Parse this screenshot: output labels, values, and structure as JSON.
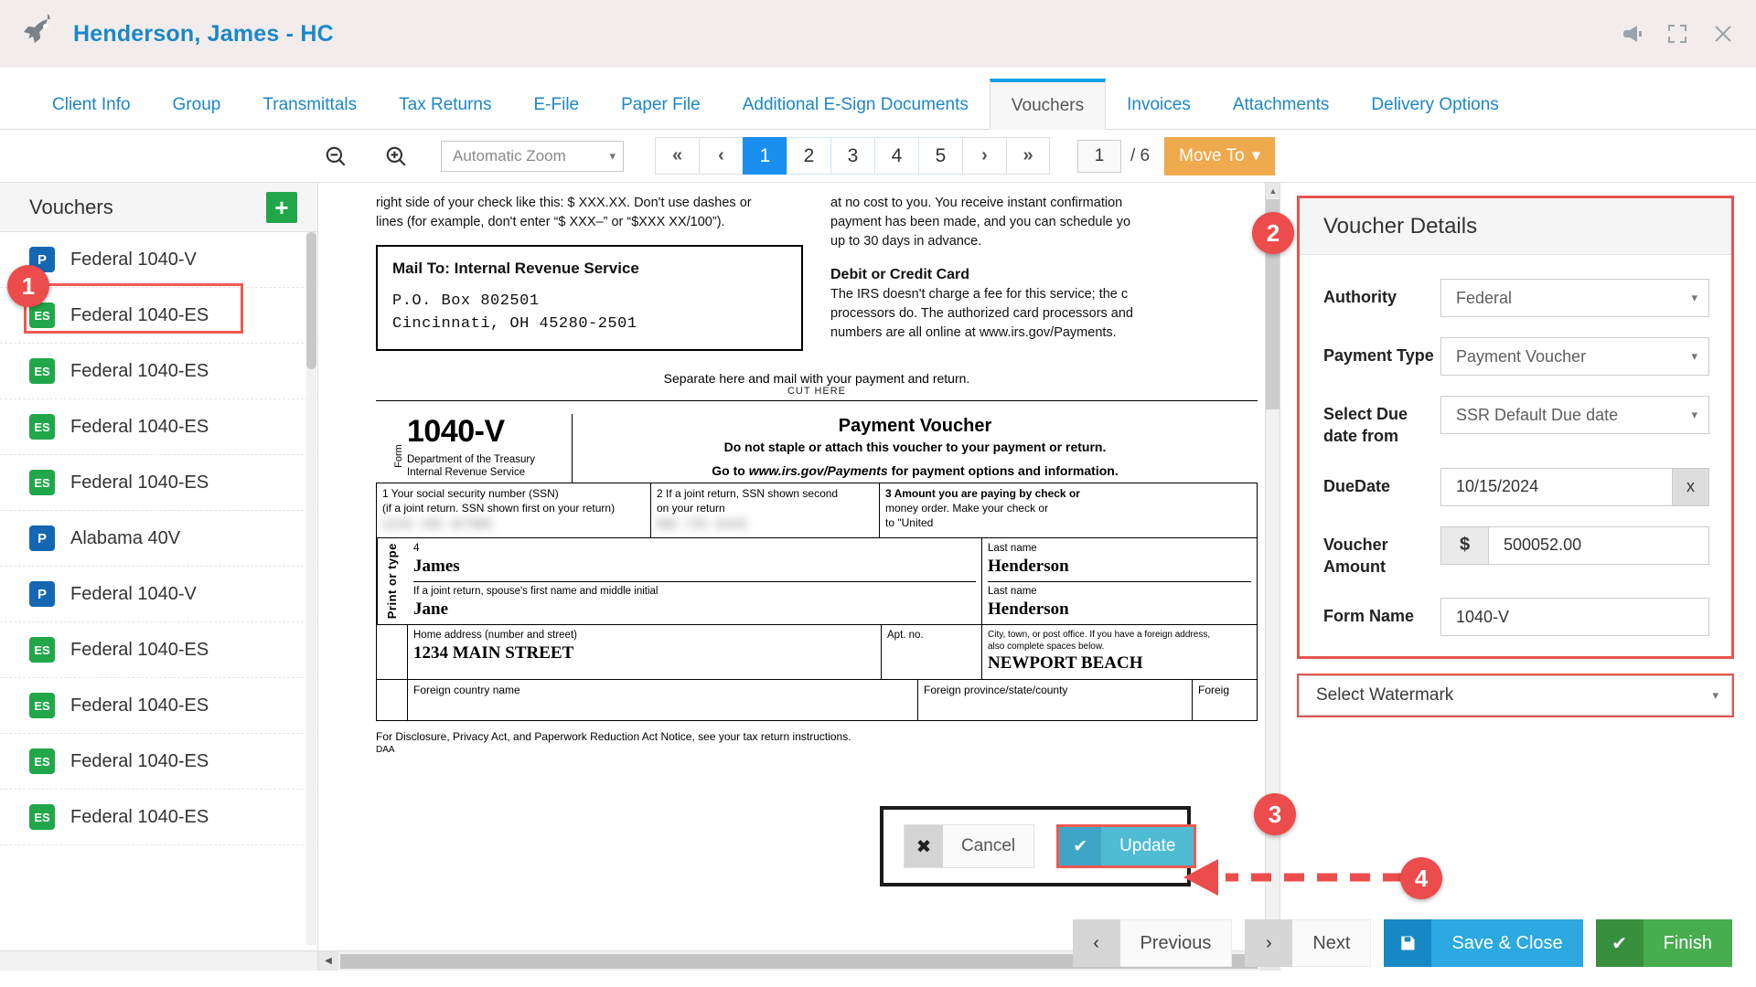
{
  "titlebar": {
    "title": "Henderson, James - HC",
    "icons": [
      "megaphone-icon",
      "expand-icon",
      "close-icon"
    ]
  },
  "tabs": [
    {
      "label": "Client Info",
      "active": false
    },
    {
      "label": "Group",
      "active": false
    },
    {
      "label": "Transmittals",
      "active": false
    },
    {
      "label": "Tax Returns",
      "active": false
    },
    {
      "label": "E-File",
      "active": false
    },
    {
      "label": "Paper File",
      "active": false
    },
    {
      "label": "Additional E-Sign Documents",
      "active": false
    },
    {
      "label": "Vouchers",
      "active": true
    },
    {
      "label": "Invoices",
      "active": false
    },
    {
      "label": "Attachments",
      "active": false
    },
    {
      "label": "Delivery Options",
      "active": false
    }
  ],
  "pdf_toolbar": {
    "zoom_out_icon": "zoom-out-icon",
    "zoom_in_icon": "zoom-in-icon",
    "zoom_level": "Automatic Zoom",
    "pager": [
      {
        "label": "«",
        "type": "nav",
        "active": false
      },
      {
        "label": "‹",
        "type": "nav",
        "active": false
      },
      {
        "label": "1",
        "type": "page",
        "active": true
      },
      {
        "label": "2",
        "type": "page",
        "active": false
      },
      {
        "label": "3",
        "type": "page",
        "active": false
      },
      {
        "label": "4",
        "type": "page",
        "active": false
      },
      {
        "label": "5",
        "type": "page",
        "active": false
      },
      {
        "label": "›",
        "type": "nav",
        "active": false
      },
      {
        "label": "»",
        "type": "nav",
        "active": false
      }
    ],
    "current_page": "1",
    "page_total": "/ 6",
    "move_to_label": "Move To"
  },
  "sidebar": {
    "title": "Vouchers",
    "add_button": "+",
    "items": [
      {
        "badge": "P",
        "type": "p",
        "label": "Federal 1040-V",
        "selected": true
      },
      {
        "badge": "ES",
        "type": "es",
        "label": "Federal 1040-ES",
        "selected": false
      },
      {
        "badge": "ES",
        "type": "es",
        "label": "Federal 1040-ES",
        "selected": false
      },
      {
        "badge": "ES",
        "type": "es",
        "label": "Federal 1040-ES",
        "selected": false
      },
      {
        "badge": "ES",
        "type": "es",
        "label": "Federal 1040-ES",
        "selected": false
      },
      {
        "badge": "P",
        "type": "p",
        "label": "Alabama 40V",
        "selected": false
      },
      {
        "badge": "P",
        "type": "p",
        "label": "Federal 1040-V",
        "selected": false
      },
      {
        "badge": "ES",
        "type": "es",
        "label": "Federal 1040-ES",
        "selected": false
      },
      {
        "badge": "ES",
        "type": "es",
        "label": "Federal 1040-ES",
        "selected": false
      },
      {
        "badge": "ES",
        "type": "es",
        "label": "Federal 1040-ES",
        "selected": false
      },
      {
        "badge": "ES",
        "type": "es",
        "label": "Federal 1040-ES",
        "selected": false
      }
    ]
  },
  "pdf": {
    "left_col_p1": "right side of your check like this: $ XXX.XX. Don't use dashes or",
    "left_col_p2": "lines (for example, don't enter “$ XXX–” or “$XXX XX/100”).",
    "mail_to_title": "Mail To: Internal Revenue Service",
    "mail_to_line1": "P.O.  Box  802501",
    "mail_to_line2": "Cincinnati,  OH  45280-2501",
    "right_col_p1": "at no cost to you. You receive instant confirmation",
    "right_col_p2": "payment has been made, and you can schedule yo",
    "right_col_p3": "up to 30 days in advance.",
    "right_col_head": "Debit or Credit Card",
    "right_col_p4": "The IRS doesn't charge a fee for this service; the c",
    "right_col_p5": "processors do. The authorized card processors and",
    "right_col_p6": "numbers are all online at www.irs.gov/Payments.",
    "separate_here": "Separate here and mail with your payment and return.",
    "cut_here": "CUT HERE",
    "form_word": "Form",
    "form_number": "1040-V",
    "dept_line1": "Department of the Treasury",
    "dept_line2": "Internal Revenue Service",
    "voucher_title": "Payment Voucher",
    "voucher_sub": "Do not staple or attach this voucher to your payment or return.",
    "voucher_go_pre": "Go to ",
    "voucher_go_url": "www.irs.gov/Payments",
    "voucher_go_post": " for payment options and information.",
    "box1_label1": "1 Your social security number (SSN)",
    "box1_label2": "(if a joint return. SSN shown first on your return)",
    "box2_label1": "2  If a joint return, SSN shown second",
    "box2_label2": "on your return",
    "box3_label1": "3  Amount you are paying by check or",
    "box3_label2": "money order. Make your check or",
    "box3_label3": "to \"United",
    "print_or_type": "Print or type",
    "line4_num": "4",
    "first_name": "James",
    "last_name_lbl": "Last name",
    "last_name": "Henderson",
    "spouse_lbl": "If a joint return, spouse's first name and middle initial",
    "spouse_name": "Jane",
    "spouse_last": "Henderson",
    "home_addr_lbl": "Home address (number and street)",
    "home_addr": "1234  MAIN  STREET",
    "apt_lbl": "Apt. no.",
    "city_lbl1": "City, town, or post office. If you have a foreign address,",
    "city_lbl2": "also complete spaces below.",
    "city": "NEWPORT  BEACH",
    "foreign_country": "Foreign country name",
    "foreign_province": "Foreign   province/state/county",
    "foreign_postal": "Foreig",
    "disclosure": "For Disclosure, Privacy Act, and Paperwork Reduction Act Notice, see your tax return instructions.",
    "daa": "DAA"
  },
  "details": {
    "title": "Voucher Details",
    "fields": [
      {
        "label": "Authority",
        "value": "Federal",
        "control": "select"
      },
      {
        "label": "Payment Type",
        "value": "Payment Voucher",
        "control": "select"
      },
      {
        "label": "Select Due date from",
        "value": "SSR Default Due date",
        "control": "select"
      },
      {
        "label": "DueDate",
        "value": "10/15/2024",
        "control": "input-clear",
        "clear": "x"
      },
      {
        "label": "Voucher Amount",
        "value": "500052.00",
        "control": "input-money",
        "prefix": "$"
      },
      {
        "label": "Form Name",
        "value": "1040-V",
        "control": "input"
      }
    ],
    "watermark": "Select Watermark"
  },
  "dialog": {
    "cancel_label": "Cancel",
    "cancel_icon": "✖",
    "update_label": "Update",
    "update_icon": "✔"
  },
  "footer": {
    "previous": "Previous",
    "next": "Next",
    "save_close": "Save & Close",
    "finish": "Finish"
  },
  "callouts": [
    {
      "number": "1"
    },
    {
      "number": "2"
    },
    {
      "number": "3"
    },
    {
      "number": "4"
    }
  ],
  "colors": {
    "brand_blue": "#1c87c9",
    "accent_blue": "#2ba9e0",
    "green": "#47ad4f",
    "orange": "#eeaa4d",
    "annotation_red": "#ec4c4c"
  }
}
